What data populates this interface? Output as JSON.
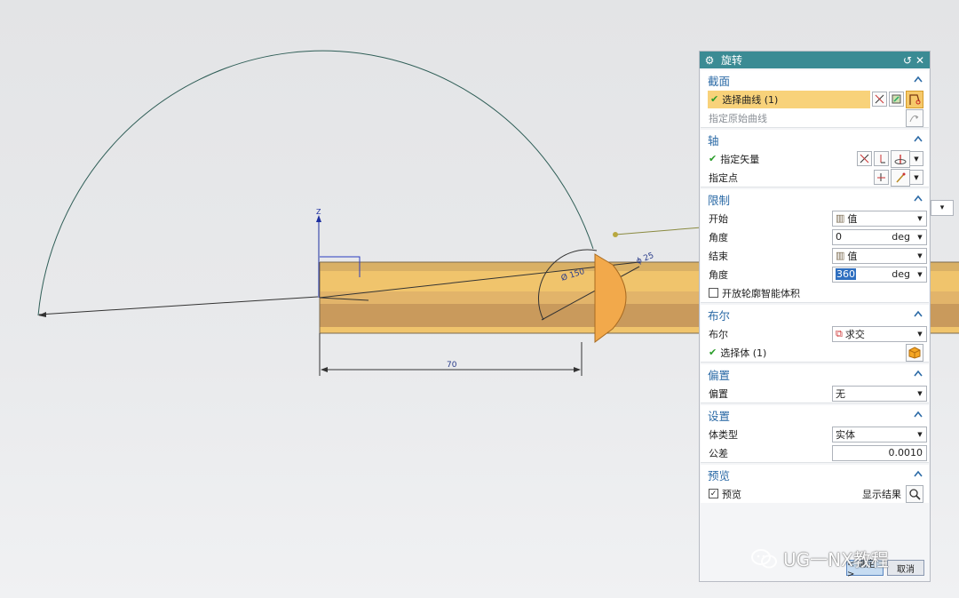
{
  "dialog": {
    "title": "旋转",
    "sections": {
      "section": {
        "header": "截面",
        "select_curve": "选择曲线 (1)",
        "specify_origin_curve": "指定原始曲线"
      },
      "axis": {
        "header": "轴",
        "specify_vector": "指定矢量",
        "specify_point": "指定点"
      },
      "limits": {
        "header": "限制",
        "start_label": "开始",
        "start_value": "值",
        "start_angle_label": "角度",
        "start_angle_value": "0",
        "end_label": "结束",
        "end_value": "值",
        "end_angle_label": "角度",
        "end_angle_value": "360",
        "unit": "deg",
        "open_profile": "开放轮廓智能体积"
      },
      "boolean": {
        "header": "布尔",
        "boolean_label": "布尔",
        "boolean_value": "求交",
        "select_body": "选择体 (1)"
      },
      "offset": {
        "header": "偏置",
        "offset_label": "偏置",
        "offset_value": "无"
      },
      "settings": {
        "header": "设置",
        "body_type_label": "体类型",
        "body_type_value": "实体",
        "tolerance_label": "公差",
        "tolerance_value": "0.0010"
      },
      "preview": {
        "header": "预览",
        "preview_label": "预览",
        "preview_checked": true,
        "show_result": "显示结果"
      }
    },
    "buttons": {
      "ok": "< 确定 >",
      "cancel": "取消"
    }
  },
  "canvas": {
    "axis_label": "Z",
    "dim_diameter": "Ø 150",
    "dim_phi": "ϕ 25",
    "dim_length": "70"
  },
  "watermark": "UG一NX教程",
  "colors": {
    "title_bar": "#3b8b94",
    "section_header_text": "#2b6aa6",
    "highlight": "#f8d27a",
    "body_fill": "#f0c46c",
    "curve": "#2f5e57"
  }
}
